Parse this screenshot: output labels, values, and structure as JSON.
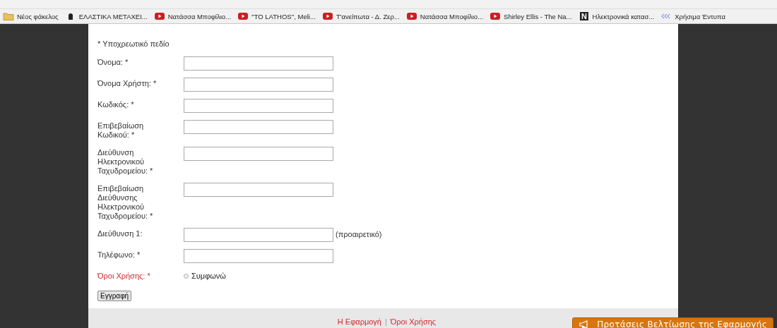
{
  "bookmarks": [
    {
      "kind": "folder",
      "label": "Νέος φάκελος"
    },
    {
      "kind": "site",
      "label": "ΕΛΑΣΤΙΚΑ ΜΕΤΑΧΕΙ..."
    },
    {
      "kind": "video",
      "label": "Νατάσσα Μποφίλιο..."
    },
    {
      "kind": "video",
      "label": "''TO LATHOS'', Meli..."
    },
    {
      "kind": "video",
      "label": "Τ'ανείπωτα - Δ. Ζερ..."
    },
    {
      "kind": "video",
      "label": "Νατάσσα Μποφίλιο..."
    },
    {
      "kind": "video",
      "label": "Shirley Ellis - The Na..."
    },
    {
      "kind": "letter",
      "letter": "N",
      "label": "Ηλεκτρονικά κατασ..."
    },
    {
      "kind": "chevrons",
      "label": "Χρήσιμα Έντυπα"
    }
  ],
  "form": {
    "notice": "* Υποχρεωτικό πεδίο",
    "rows": [
      {
        "kind": "text",
        "label": "Όνομα: *"
      },
      {
        "kind": "text",
        "label": "Όνομα Χρήστη: *"
      },
      {
        "kind": "text",
        "label": "Κωδικός: *"
      },
      {
        "kind": "text",
        "label": "Επιβεβαίωση Κωδικού: *"
      },
      {
        "kind": "text",
        "label": "Διεύθυνση Ηλεκτρονικού Ταχυδρομείου: *"
      },
      {
        "kind": "text",
        "label": "Επιβεβαίωση Διεύθυνσης Ηλεκτρονικού Ταχυδρομείου: *"
      },
      {
        "kind": "text",
        "label": "Διεύθυνση 1:",
        "note": "(προαιρετικό)"
      },
      {
        "kind": "text",
        "label": "Τηλέφωνο: *"
      },
      {
        "kind": "radio",
        "label": "Όροι Χρήσης: *",
        "option": "Συμφωνώ",
        "selected": false
      }
    ],
    "submit": "Εγγραφή"
  },
  "footer": {
    "links": [
      {
        "kind": "link",
        "text": "Η Εφαρμογή"
      },
      {
        "kind": "separator",
        "text": "|"
      },
      {
        "kind": "link",
        "text": "Όροι Χρήσης"
      }
    ]
  },
  "feedback_button": "Προτάσεις Βελτίωσης της Εφαρμογής"
}
